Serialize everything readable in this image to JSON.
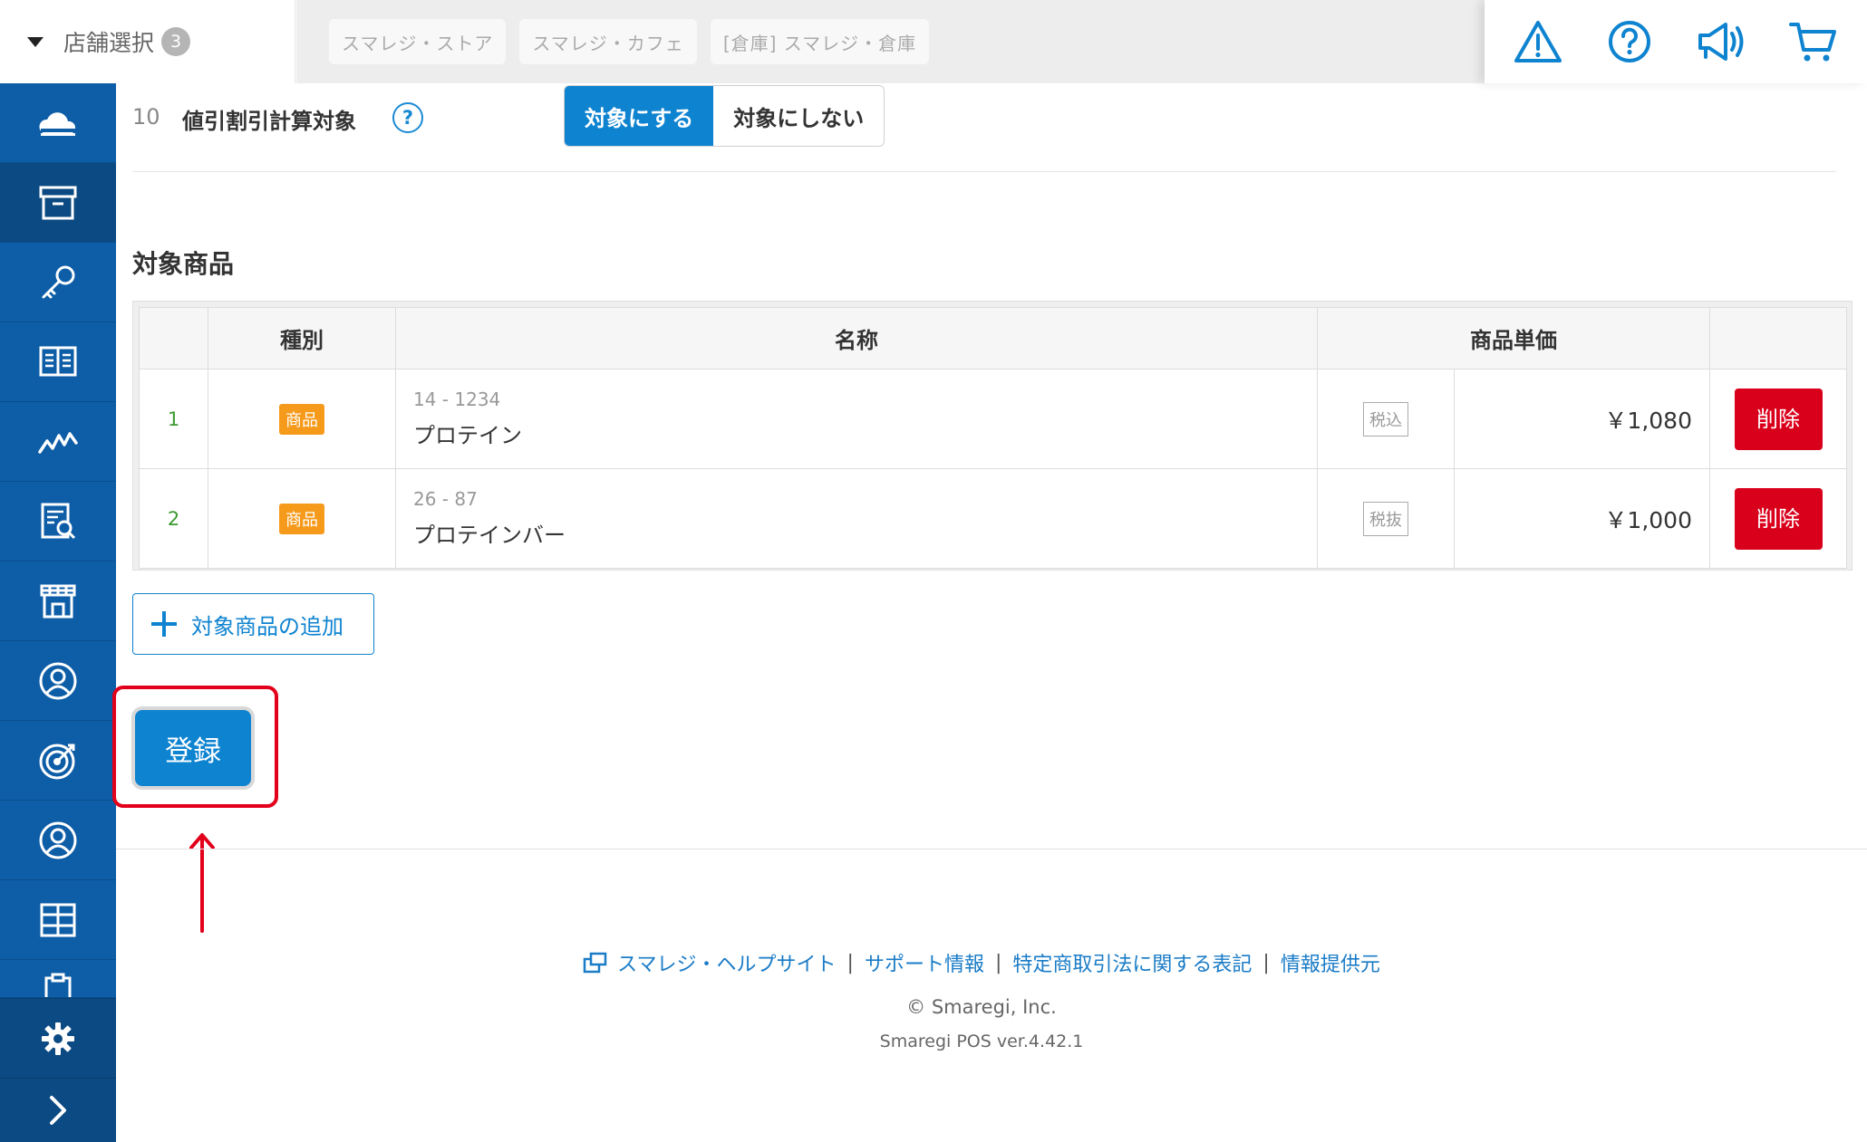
{
  "header": {
    "store_select_label": "店舗選択",
    "store_count": "3",
    "store_tabs": [
      "スマレジ・ストア",
      "スマレジ・カフェ",
      "[倉庫] スマレジ・倉庫"
    ],
    "icons": [
      "warning-icon",
      "help-icon",
      "megaphone-icon",
      "cart-icon"
    ]
  },
  "sidebar": {
    "items": [
      "cloud-icon",
      "box-icon",
      "key-icon",
      "book-icon",
      "chart-line-icon",
      "report-icon",
      "store-icon",
      "staff-icon",
      "target-icon",
      "customer-icon",
      "grid-icon",
      "clipboard-icon"
    ],
    "active_index": 1,
    "bottom": [
      "gear-icon",
      "chevron-right-icon"
    ]
  },
  "setting": {
    "number": "10",
    "label": "値引割引計算対象",
    "help": "?",
    "toggle_on": "対象にする",
    "toggle_off": "対象にしない"
  },
  "products": {
    "title": "対象商品",
    "columns": [
      "",
      "種別",
      "名称",
      "商品単価",
      ""
    ],
    "rows": [
      {
        "num": "1",
        "type": "商品",
        "code": "14 - 1234",
        "name": "プロテイン",
        "tax": "税込",
        "price": "￥1,080",
        "action": "削除"
      },
      {
        "num": "2",
        "type": "商品",
        "code": "26 - 87",
        "name": "プロテインバー",
        "tax": "税抜",
        "price": "￥1,000",
        "action": "削除"
      }
    ],
    "add_label": "対象商品の追加"
  },
  "actions": {
    "register_label": "登録"
  },
  "footer": {
    "links": [
      "スマレジ・ヘルプサイト",
      "サポート情報",
      "特定商取引法に関する表記",
      "情報提供元"
    ],
    "copyright": "© Smaregi, Inc.",
    "version": "Smaregi POS ver.4.42.1"
  },
  "colors": {
    "primary": "#0e83d0",
    "sidebar": "#0d5da7",
    "danger": "#d9001b",
    "badge": "#f59a1b",
    "highlight": "#e3001b"
  }
}
